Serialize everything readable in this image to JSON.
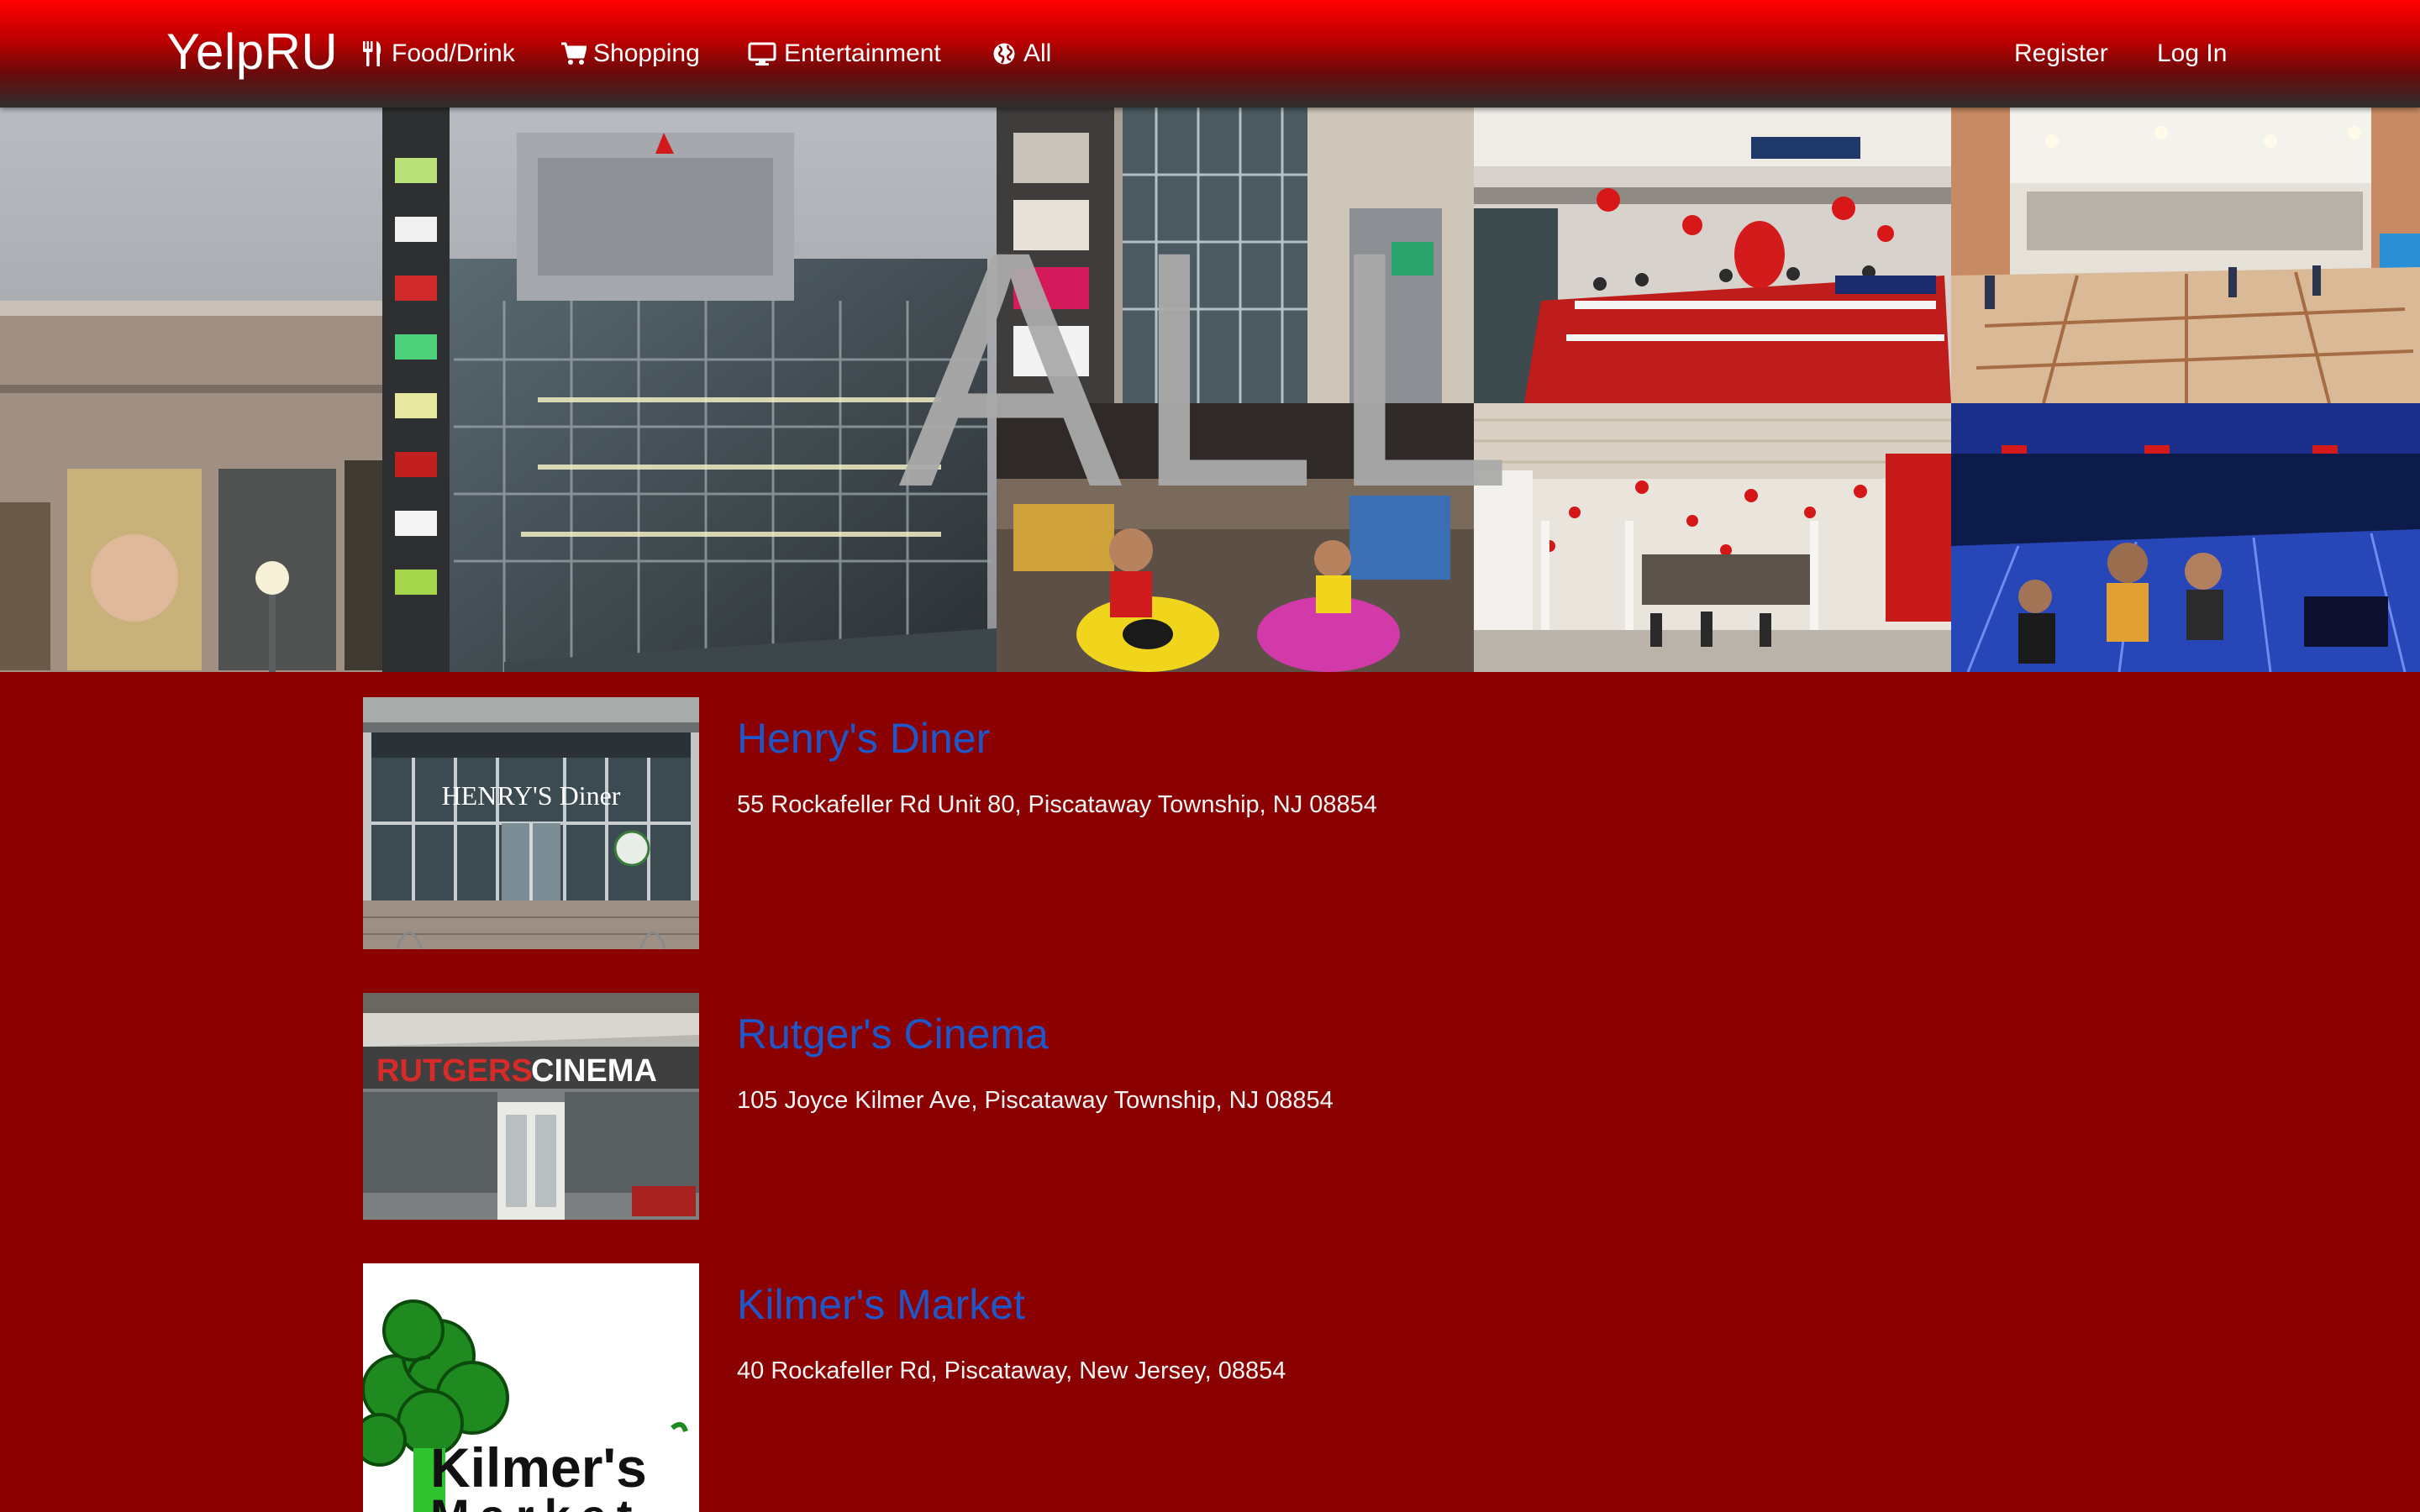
{
  "navbar": {
    "brand": "YelpRU",
    "links": [
      {
        "label": "Food/Drink",
        "icon": "cutlery-icon"
      },
      {
        "label": "Shopping",
        "icon": "shopping-cart-icon"
      },
      {
        "label": "Entertainment",
        "icon": "monitor-icon"
      },
      {
        "label": "All",
        "icon": "globe-icon"
      }
    ],
    "right_links": [
      {
        "label": "Register"
      },
      {
        "label": "Log In"
      }
    ]
  },
  "hero": {
    "title": "ALL"
  },
  "listings": [
    {
      "name": "Henry's Diner",
      "address": "55 Rockafeller Rd Unit 80, Piscataway Township, NJ 08854",
      "sign_text": "HENRY'S Diner"
    },
    {
      "name": "Rutger's Cinema",
      "address": "105 Joyce Kilmer Ave, Piscataway Township, NJ 08854",
      "sign_text_1": "RUTGERS",
      "sign_text_2": "CINEMA"
    },
    {
      "name": "Kilmer's Market",
      "address": "40 Rockafeller Rd, Piscataway, New Jersey, 08854",
      "logo_text_1": "Kilmer's",
      "logo_text_2": "Market"
    }
  ],
  "colors": {
    "page_background": "#8b0000",
    "navbar_top": "#ff0000",
    "navbar_bottom": "#2e2e2e",
    "link_blue": "#1f57c8",
    "hero_title": "#aaaaaa"
  }
}
